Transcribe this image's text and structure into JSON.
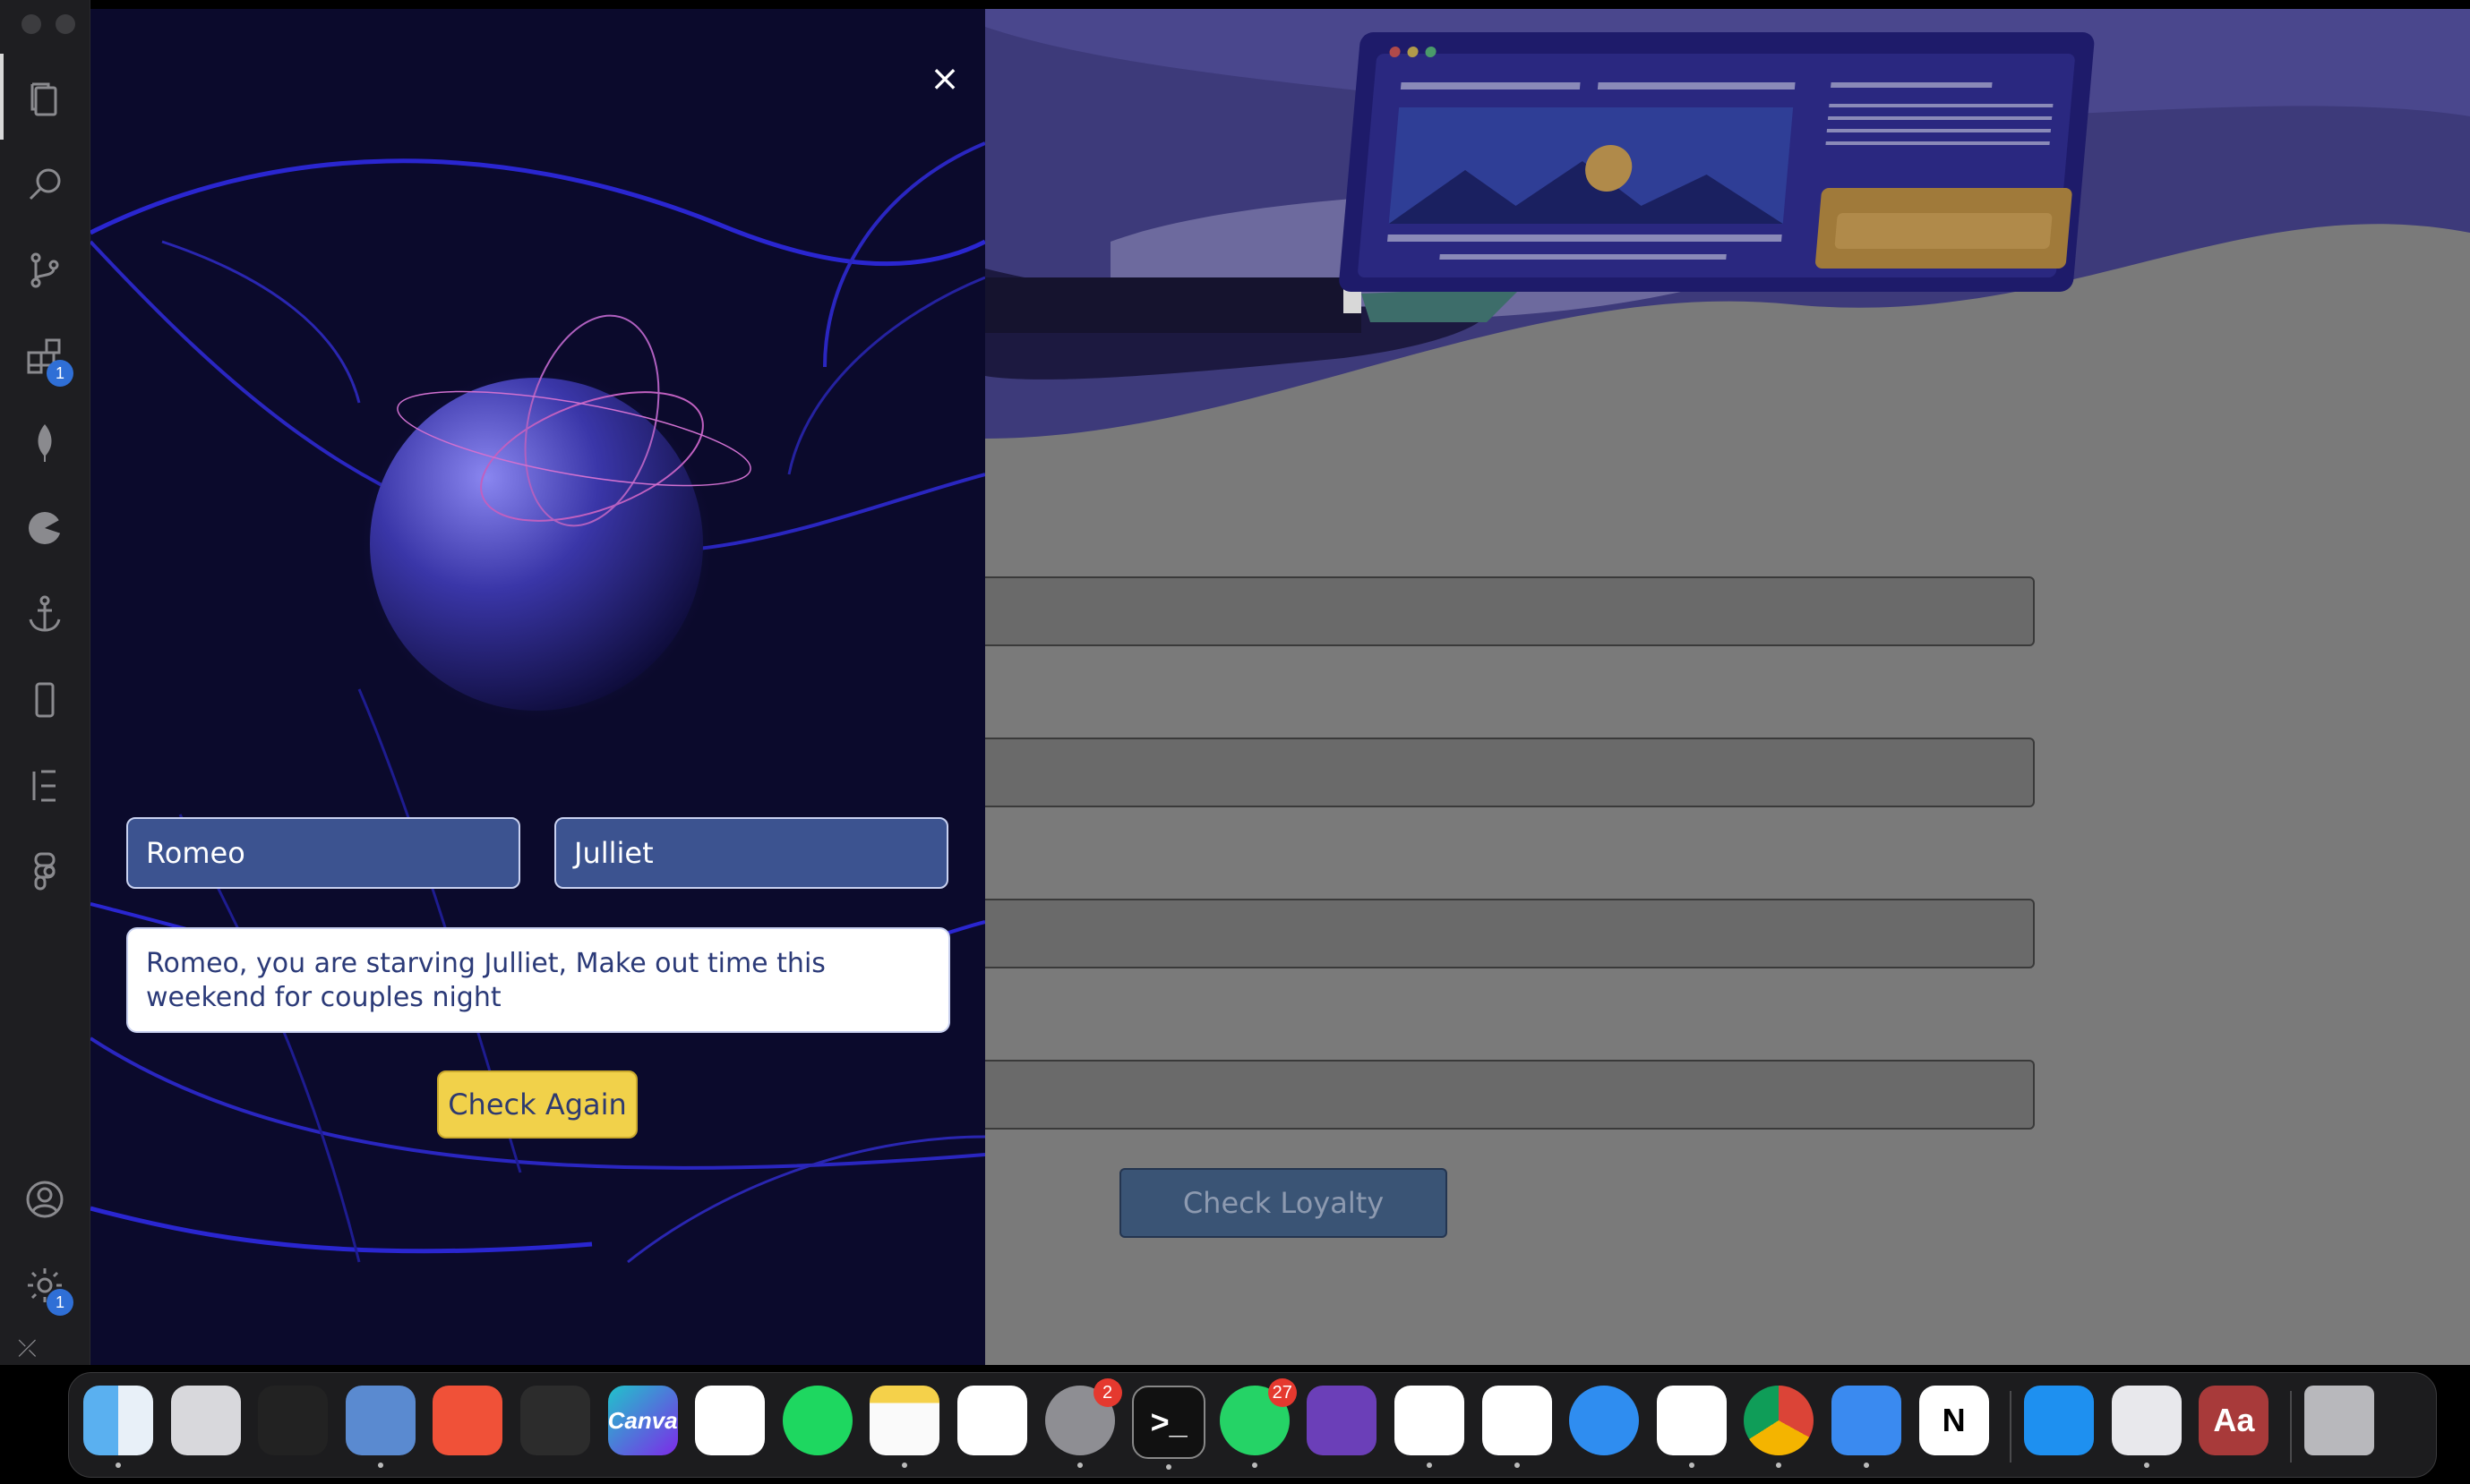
{
  "activity_bar": {
    "items": [
      {
        "icon": "files-icon"
      },
      {
        "icon": "search-icon"
      },
      {
        "icon": "source-control-icon"
      },
      {
        "icon": "extensions-icon",
        "badge": "1"
      },
      {
        "icon": "mongodb-leaf-icon"
      },
      {
        "icon": "pie-chart-icon"
      },
      {
        "icon": "anchor-icon"
      },
      {
        "icon": "mobile-device-icon"
      },
      {
        "icon": "elementor-icon"
      },
      {
        "icon": "figma-icon"
      }
    ],
    "account_icon": "account-icon",
    "settings": {
      "icon": "gear-icon",
      "badge": "1"
    }
  },
  "modal": {
    "close_label": "×",
    "name1": "Romeo",
    "name2": "Julliet",
    "result": "Romeo, you are starving Julliet, Make out time this weekend for couples night",
    "check_again_label": "Check Again"
  },
  "background_app": {
    "check_loyalty_label": "Check Loyalty"
  },
  "dock": {
    "apps": [
      {
        "name": "finder",
        "label": ""
      },
      {
        "name": "launchpad",
        "label": ""
      },
      {
        "name": "mission-control",
        "label": ""
      },
      {
        "name": "no-access",
        "label": ""
      },
      {
        "name": "swift",
        "label": ""
      },
      {
        "name": "figma",
        "label": ""
      },
      {
        "name": "canva",
        "label": "Canva"
      },
      {
        "name": "infuse",
        "label": ""
      },
      {
        "name": "spotify",
        "label": ""
      },
      {
        "name": "notes",
        "label": ""
      },
      {
        "name": "freeform",
        "label": ""
      },
      {
        "name": "system-settings",
        "label": "",
        "badge": "2"
      },
      {
        "name": "terminal",
        "label": ">_"
      },
      {
        "name": "whatsapp",
        "label": "",
        "badge": "27"
      },
      {
        "name": "visual-studio",
        "label": ""
      },
      {
        "name": "vscode",
        "label": ""
      },
      {
        "name": "brave",
        "label": ""
      },
      {
        "name": "safari",
        "label": ""
      },
      {
        "name": "opera",
        "label": ""
      },
      {
        "name": "chrome",
        "label": ""
      },
      {
        "name": "xcode-instruments",
        "label": ""
      },
      {
        "name": "notion",
        "label": "N"
      },
      {
        "name": "app-store",
        "label": ""
      },
      {
        "name": "preview",
        "label": ""
      },
      {
        "name": "dictionary",
        "label": "Aa"
      },
      {
        "name": "trash",
        "label": ""
      }
    ]
  }
}
